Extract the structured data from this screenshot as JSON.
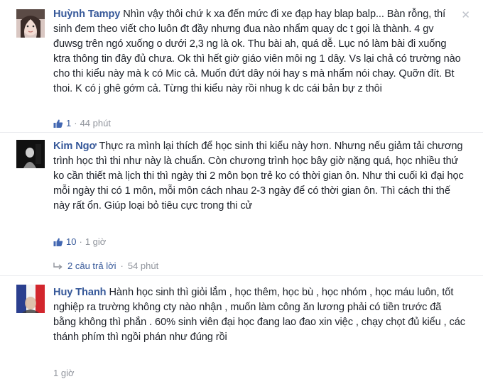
{
  "comments": [
    {
      "name": "Huỳnh Tampy",
      "text": "Nhìn vậy thôi chứ k xa đến mức đi xe đạp hay blap balp... Bàn rỗng, thí sinh đem theo viết cho luôn đt đầy nhưng đua nào nhẩm quay dc t gọi là thành. 4 gv đuwsg trên ngó xuống o dưới 2,3 ng là ok. Thu bài ah, quá dễ. Lục nó làm bài đi xuống ktra thông tin đây đủ chưa. Ok thì hết giờ giáo viên môi ng 1 dây. Vs lại chả có trường nào cho thi kiểu này mà k có Mic cả. Muốn đứt dây nói hay s mà nhẩm nói chay. Quỡn đít. Bt thoi. K có j ghê gớm cả. Từng thi kiểu này rồi nhug k dc cái bản bự z thôi",
      "likes": "1",
      "sep": "·",
      "time": "44 phút"
    },
    {
      "name": "Kim Ngơ",
      "text": "Thực ra mình lại thích để học sinh thi kiểu này hơn. Nhưng nếu giảm tải chương trình học thì thi như này là chuẩn. Còn chương trình học bây giờ nặng quá, học nhiều thứ ko cần thiết mà lịch thi thì ngày thi 2 môn bọn trẻ ko có thời gian ôn. Như thi cuối kì đại học mỗi ngày thi có 1 môn, mỗi môn cách nhau 2-3 ngày để có thời gian ôn. Thì cách thi thế này rất ổn. Giúp loại bỏ tiêu cực trong thi cử",
      "likes": "10",
      "sep": "·",
      "time": "1 giờ",
      "replies_label": "2 câu trả lời",
      "replies_time": "54 phút"
    },
    {
      "name": "Huy Thanh",
      "text": "Hành học sinh thì giỏi lắm , học thêm, học bù , học nhóm , học máu luôn, tốt nghiệp ra trường không cty nào nhận , muốn làm công ăn lương phải có tiền trước đã bằng không thì phắn . 60% sinh viên đại học đang lao đao xin việc , chạy chọt đủ kiểu , các thánh phím thì ngồi phán như đúng rồi",
      "time": "1 giờ"
    }
  ],
  "colors": {
    "link": "#365899",
    "meta": "#90949c",
    "text": "#1d2129"
  },
  "icons": {
    "like": "thumbs-up-icon",
    "reply": "reply-arrow-icon",
    "close": "close-icon"
  }
}
